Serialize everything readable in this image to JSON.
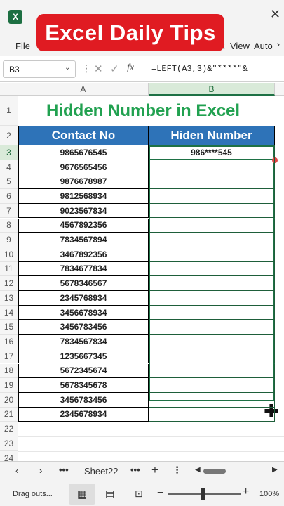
{
  "app": {
    "logo_letter": "X",
    "banner_title": "Excel Daily Tips",
    "colors": {
      "banner": "#e01b22",
      "excel_green": "#1d6f42",
      "header_blue": "#2e73b8",
      "title_green": "#21a150"
    }
  },
  "ribbon": {
    "tabs": [
      "File",
      "x",
      "View",
      "Auto"
    ],
    "more_icon": "chevron-right-icon"
  },
  "formula_bar": {
    "name_box": "B3",
    "fx": "fx",
    "formula": "=LEFT(A3,3)&\"****\"&"
  },
  "columns": [
    "A",
    "B"
  ],
  "sheet": {
    "title": "Hidden Number in Excel",
    "header_a": "Contact No",
    "header_b": "Hiden Number",
    "row_numbers": [
      "1",
      "2",
      "3",
      "4",
      "5",
      "6",
      "7",
      "8",
      "9",
      "10",
      "11",
      "12",
      "13",
      "14",
      "15",
      "16",
      "17",
      "18",
      "19",
      "20",
      "21",
      "22",
      "23",
      "24"
    ],
    "contacts": [
      "9865676545",
      "9676565456",
      "9876678987",
      "9812568934",
      "9023567834",
      "4567892356",
      "7834567894",
      "3467892356",
      "7834677834",
      "5678346567",
      "2345768934",
      "3456678934",
      "3456783456",
      "7834567834",
      "1235667345",
      "5672345674",
      "5678345678",
      "3456783456",
      "2345678934"
    ],
    "hidden": [
      "986****545"
    ]
  },
  "sheet_tabs": {
    "active": "Sheet22",
    "more": "•••"
  },
  "status": {
    "text": "Drag outs...",
    "zoom": "100%",
    "zoom_fraction": 0.45
  }
}
